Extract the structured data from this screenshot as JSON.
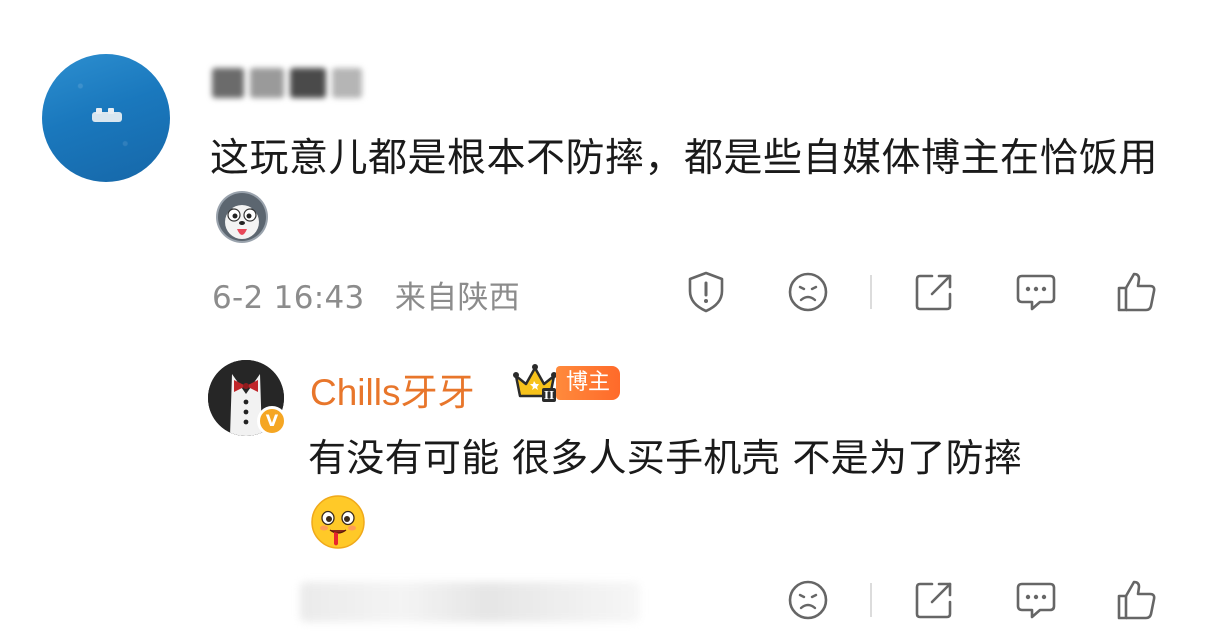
{
  "comment1": {
    "author_hidden": true,
    "text": "这玩意儿都是根本不防摔，都是些自媒体博主在恰饭用",
    "emoji": "husky-tongue-emoji",
    "date": "6-2 16:43",
    "location": "来自陕西"
  },
  "reply": {
    "author": "Chills牙牙",
    "tag": "博主",
    "badge_level": "II",
    "verified_mark": "V",
    "text": "有没有可能 很多人买手机壳 不是为了防摔",
    "emoji": "drooling-face-emoji"
  },
  "colors": {
    "author_name": "#e8762b",
    "tag_bg": "#ff7a30",
    "icon_stroke": "#666666",
    "meta_text": "#8c8c8c"
  }
}
